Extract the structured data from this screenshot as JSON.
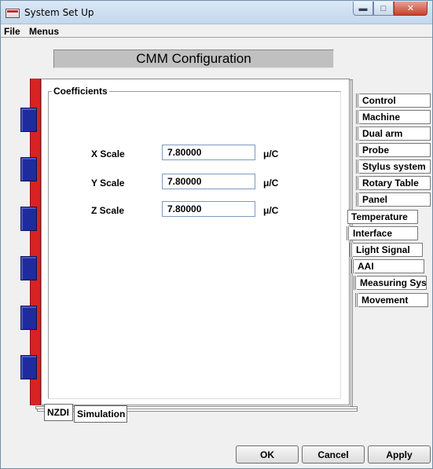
{
  "window": {
    "title": "System Set Up"
  },
  "menu": {
    "file": "File",
    "menus": "Menus"
  },
  "header": {
    "title": "CMM Configuration"
  },
  "group": {
    "title": "Coefficients"
  },
  "fields": [
    {
      "label": "X Scale",
      "value": "7.80000",
      "unit": "μ/C"
    },
    {
      "label": "Y Scale",
      "value": "7.80000",
      "unit": "μ/C"
    },
    {
      "label": "Z Scale",
      "value": "7.80000",
      "unit": "μ/C"
    }
  ],
  "right_tabs": [
    "Control",
    "Machine",
    "Dual arm",
    "Probe",
    "Stylus system",
    "Rotary Table",
    "Panel",
    "Temperature",
    "Interface",
    "Light Signal",
    "AAI",
    "Measuring Sys",
    "Movement"
  ],
  "bottom_tabs": {
    "active": "NZDI",
    "other": "Simulation"
  },
  "buttons": {
    "ok": "OK",
    "cancel": "Cancel",
    "apply": "Apply"
  },
  "colors": {
    "spine": "#d92222",
    "rings": "#1f2a9e",
    "title_gradient": "#c4d7ec"
  },
  "window_controls": {
    "minimize_icon": "minimize-icon",
    "maximize_icon": "maximize-icon",
    "close_icon": "close-icon"
  }
}
